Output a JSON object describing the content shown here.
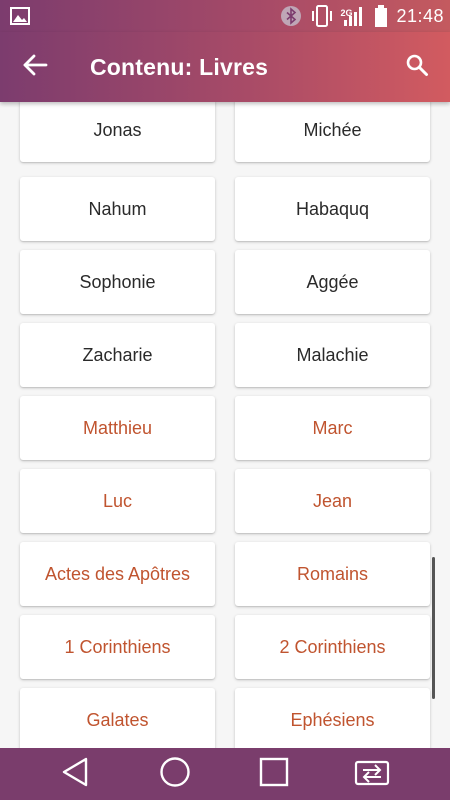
{
  "status_bar": {
    "time": "21:48",
    "network_label": "2G",
    "icons": [
      "image-icon",
      "bluetooth-icon",
      "vibrate-icon",
      "signal-icon",
      "battery-icon"
    ]
  },
  "app_bar": {
    "title": "Contenu: Livres",
    "back_icon": "arrow-back-icon",
    "search_icon": "search-icon"
  },
  "books": {
    "rows": [
      {
        "left": "Jonas",
        "right": "Michée",
        "testament": "old"
      },
      {
        "left": "Nahum",
        "right": "Habaquq",
        "testament": "old"
      },
      {
        "left": "Sophonie",
        "right": "Aggée",
        "testament": "old"
      },
      {
        "left": "Zacharie",
        "right": "Malachie",
        "testament": "old"
      },
      {
        "left": "Matthieu",
        "right": "Marc",
        "testament": "new"
      },
      {
        "left": "Luc",
        "right": "Jean",
        "testament": "new"
      },
      {
        "left": "Actes des Apôtres",
        "right": "Romains",
        "testament": "new"
      },
      {
        "left": "1 Corinthiens",
        "right": "2 Corinthiens",
        "testament": "new"
      },
      {
        "left": "Galates",
        "right": "Ephésiens",
        "testament": "new"
      }
    ]
  },
  "colors": {
    "old_testament_text": "#2a2a2a",
    "new_testament_text": "#c0542f",
    "app_bar_start": "#7c3c6e",
    "app_bar_end": "#d25b60",
    "nav_bar": "#7a3d6c"
  },
  "nav_bar": {
    "icons": [
      "back-triangle-icon",
      "home-circle-icon",
      "recents-square-icon",
      "switch-sim-icon"
    ]
  }
}
